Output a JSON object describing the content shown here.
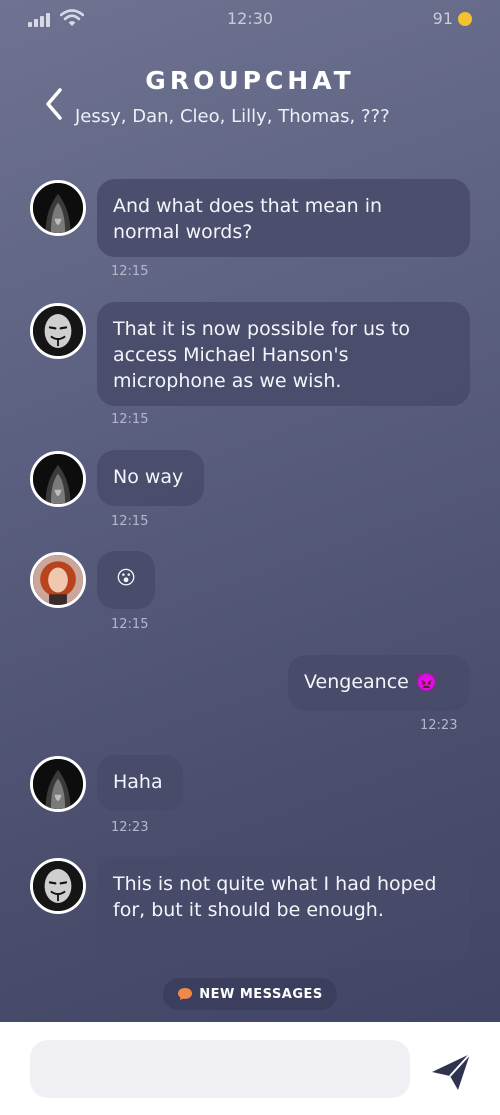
{
  "status": {
    "time": "12:30",
    "battery": "91"
  },
  "header": {
    "title": "GROUPCHAT",
    "members": "Jessy, Dan, Cleo, Lilly, Thomas, ???"
  },
  "messages": [
    {
      "text": "And what does that mean in normal words?",
      "time": "12:15",
      "avatar": "hooded-man-avatar"
    },
    {
      "text": "That it is now possible for us to access Michael Hanson's microphone as we wish.",
      "time": "12:15",
      "avatar": "anonymous-mask-avatar"
    },
    {
      "text": "No way",
      "time": "12:15",
      "avatar": "hooded-man-avatar"
    },
    {
      "text": "😮",
      "time": "12:15",
      "avatar": "red-haired-woman-avatar"
    },
    {
      "text": "Vengeance 👿",
      "time": "12:23",
      "outgoing": true
    },
    {
      "text": "Haha",
      "time": "12:23",
      "avatar": "hooded-man-avatar"
    },
    {
      "text": "This is not quite what I had hoped for, but it should be enough.",
      "time": "",
      "avatar": "anonymous-mask-avatar"
    }
  ],
  "new_messages_label": "NEW MESSAGES",
  "composer": {
    "placeholder": ""
  },
  "colors": {
    "accent": "#2f3350",
    "badge": "#f08a4b",
    "battery": "#f2c230"
  }
}
